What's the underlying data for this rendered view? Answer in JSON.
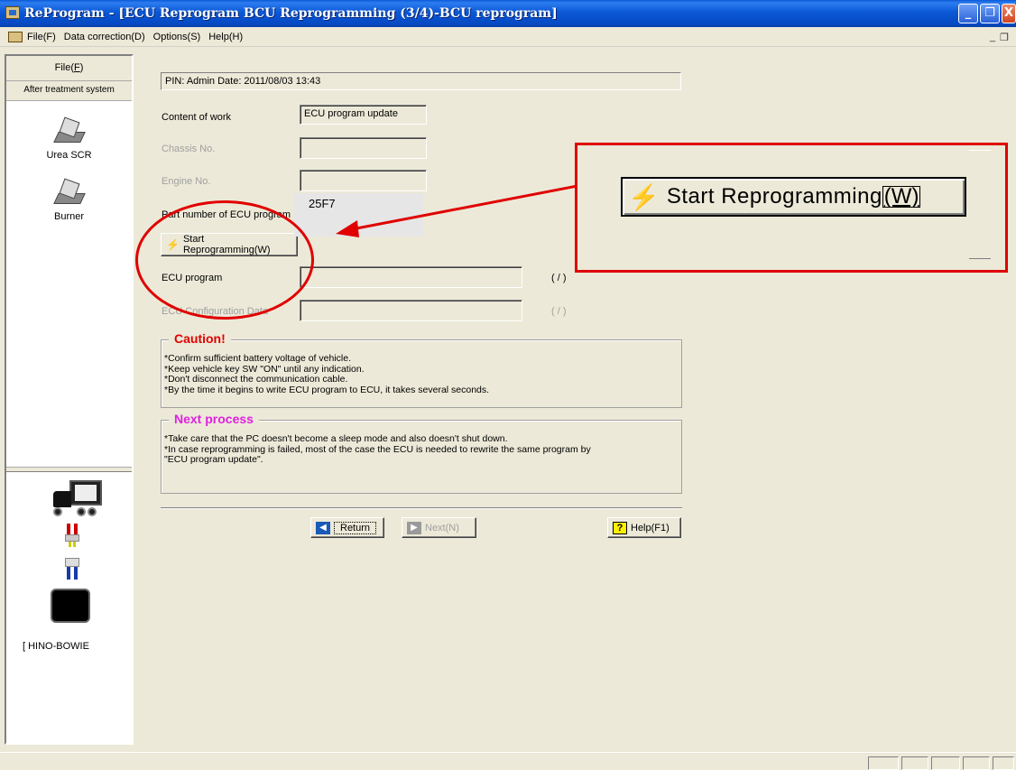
{
  "window": {
    "title": "ReProgram - [ECU Reprogram BCU Reprogramming (3/4)-BCU reprogram]",
    "minimize": "_",
    "restore": "❐",
    "close": "X"
  },
  "menu": {
    "items": [
      "File(F)",
      "Data correction(D)",
      "Options(S)",
      "Help(H)"
    ],
    "mdi_minimize": "_",
    "mdi_restore": "❐"
  },
  "sidebar": {
    "header": "File(F)",
    "header_hotkey_display": "File(",
    "header_hotkey_letter": "F",
    "subheader": "After treatment system",
    "items": [
      {
        "label": "Urea SCR",
        "icon": "pencil-plate-icon"
      },
      {
        "label": "Burner",
        "icon": "pencil-plate-icon"
      }
    ],
    "vehicle_label": "[ HINO-BOWIE"
  },
  "main": {
    "pin_line": "PIN: Admin  Date: 2011/08/03 13:43",
    "content_of_work_label": "Content of work",
    "content_of_work_value": "ECU program update",
    "chassis_label": "Chassis No.",
    "chassis_value": "",
    "engine_label": "Engine No.",
    "engine_value": "",
    "part_number_label": "Part number of ECU program",
    "start_button": "Start Reprogramming(W)",
    "ecu_program_label": "ECU program",
    "ecu_program_count": "(       /       )",
    "ecu_config_label": "ECU Configuration Data",
    "ecu_config_count": "(       /       )"
  },
  "tooltip": {
    "text": "25F7"
  },
  "caution": {
    "title": "Caution!",
    "lines": [
      "*Confirm sufficient battery voltage of vehicle.",
      " *Keep vehicle key SW \"ON\" until any indication.",
      " *Don't disconnect the communication cable.",
      " *By the time it begins to write ECU program to ECU, it takes several seconds."
    ]
  },
  "next_process": {
    "title": "Next process",
    "lines": [
      "*Take care that the PC doesn't become a sleep mode and also doesn't shut down.",
      " *In case reprogramming is failed, most of the case the ECU is needed to rewrite the same program by",
      "\"ECU program update\"."
    ]
  },
  "footer_buttons": {
    "return": "Return",
    "next": "Next(N)",
    "help": "Help(F1)"
  },
  "callout": {
    "label_main": "Start Reprogramming",
    "label_key": "(W)"
  },
  "colors": {
    "highlight_red": "#e00000",
    "caution_red": "#e00000",
    "next_magenta": "#e020e0",
    "titlebar_blue": "#0b58d6"
  }
}
